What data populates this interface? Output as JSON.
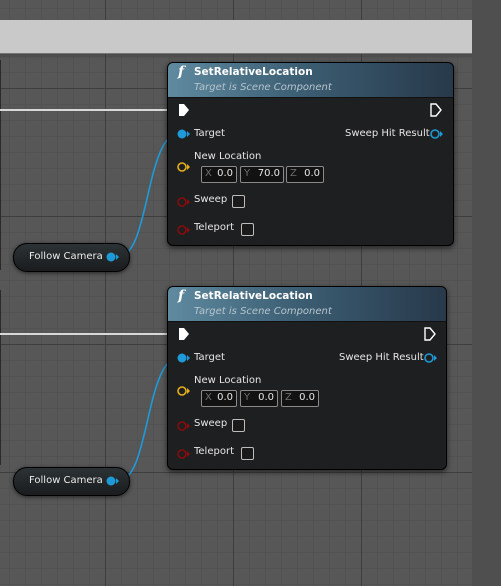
{
  "colors": {
    "object_pin": "#1e9ad8",
    "struct_pin": "#e8b11a",
    "bool_pin": "#8a0c0c",
    "exec_pin": "#ffffff"
  },
  "nodes": [
    {
      "title": "SetRelativeLocation",
      "subtitle": "Target is Scene Component",
      "function_icon": "f",
      "target_label": "Target",
      "sweep_hit_label": "Sweep Hit Result",
      "new_location_label": "New Location",
      "location": {
        "x_axis": "X",
        "x": "0.0",
        "y_axis": "Y",
        "y": "70.0",
        "z_axis": "Z",
        "z": "0.0"
      },
      "sweep_label": "Sweep",
      "teleport_label": "Teleport"
    },
    {
      "title": "SetRelativeLocation",
      "subtitle": "Target is Scene Component",
      "function_icon": "f",
      "target_label": "Target",
      "sweep_hit_label": "Sweep Hit Result",
      "new_location_label": "New Location",
      "location": {
        "x_axis": "X",
        "x": "0.0",
        "y_axis": "Y",
        "y": "0.0",
        "z_axis": "Z",
        "z": "0.0"
      },
      "sweep_label": "Sweep",
      "teleport_label": "Teleport"
    }
  ],
  "variables": [
    {
      "label": "Follow Camera"
    },
    {
      "label": "Follow Camera"
    }
  ]
}
